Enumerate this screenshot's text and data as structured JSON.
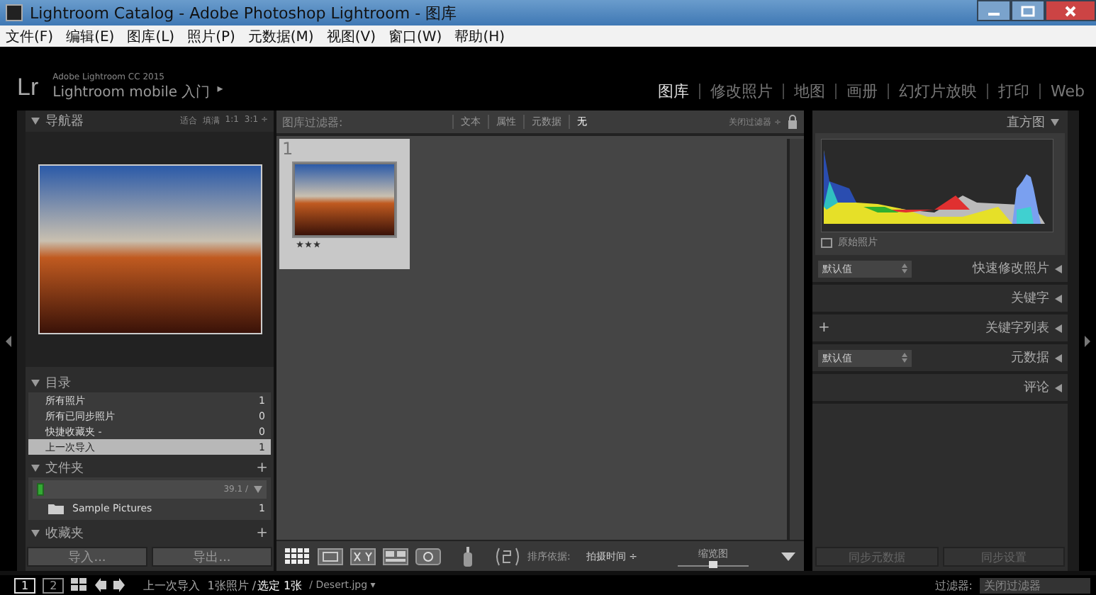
{
  "window": {
    "title": "Lightroom Catalog - Adobe Photoshop Lightroom - 图库"
  },
  "menu": [
    "文件(F)",
    "编辑(E)",
    "图库(L)",
    "照片(P)",
    "元数据(M)",
    "视图(V)",
    "窗口(W)",
    "帮助(H)"
  ],
  "identity": {
    "logo": "Lr",
    "product": "Adobe Lightroom CC 2015",
    "mobile": "Lightroom mobile 入门",
    "mobile_arrow": "▸"
  },
  "modules": [
    {
      "label": "图库",
      "selected": true
    },
    {
      "label": "修改照片",
      "selected": false
    },
    {
      "label": "地图",
      "selected": false
    },
    {
      "label": "画册",
      "selected": false
    },
    {
      "label": "幻灯片放映",
      "selected": false
    },
    {
      "label": "打印",
      "selected": false
    },
    {
      "label": "Web",
      "selected": false
    }
  ],
  "navigator": {
    "title": "导航器",
    "zoom_options": [
      {
        "label": "适合",
        "selected": false
      },
      {
        "label": "填满",
        "selected": false
      },
      {
        "label": "1:1",
        "selected": false
      },
      {
        "label": "3:1 ÷",
        "selected": false
      }
    ]
  },
  "catalog": {
    "title": "目录",
    "items": [
      {
        "label": "所有照片",
        "count": "1",
        "selected": false
      },
      {
        "label": "所有已同步照片",
        "count": "0",
        "selected": false
      },
      {
        "label": "快捷收藏夹 -",
        "count": "0",
        "selected": false
      },
      {
        "label": "上一次导入",
        "count": "1",
        "selected": true
      }
    ]
  },
  "folders": {
    "title": "文件夹",
    "add": "+",
    "volume_size": "39.1 /",
    "items": [
      {
        "label": "Sample Pictures",
        "count": "1"
      }
    ]
  },
  "collections": {
    "title": "收藏夹",
    "add": "+"
  },
  "left_buttons": [
    "导入...",
    "导出..."
  ],
  "filter_bar": {
    "label": "图库过滤器:",
    "options": [
      {
        "label": "文本",
        "selected": false
      },
      {
        "label": "属性",
        "selected": false
      },
      {
        "label": "元数据",
        "selected": false
      },
      {
        "label": "无",
        "selected": true
      }
    ],
    "preset": "关闭过滤器 ÷"
  },
  "grid": {
    "cells": [
      {
        "index": "1",
        "stars": 3,
        "selected": true
      }
    ]
  },
  "toolbar": {
    "sort_label": "排序依据:",
    "sort_value": "拍摄时间 ÷",
    "thumb_label": "缩览图",
    "thumb_slider": {
      "level": 0.5
    }
  },
  "right_panel": {
    "histogram_title": "直方图",
    "original_photo": {
      "label": "原始照片",
      "checked": false
    },
    "sections": [
      {
        "kind": "preset",
        "preset": "默认值",
        "title": "快速修改照片"
      },
      {
        "kind": "plain",
        "title": "关键字"
      },
      {
        "kind": "add",
        "add": "+",
        "title": "关键字列表"
      },
      {
        "kind": "preset",
        "preset": "默认值",
        "title": "元数据"
      },
      {
        "kind": "plain",
        "title": "评论"
      }
    ],
    "buttons": [
      "同步元数据",
      "同步设置"
    ]
  },
  "filmstrip": {
    "pages": [
      {
        "label": "1",
        "selected": true
      },
      {
        "label": "2",
        "selected": false
      }
    ],
    "source": "上一次导入",
    "info": "1张照片 / ",
    "selected_info": "选定 1张",
    "file": "/ Desert.jpg ▾",
    "filter_label": "过滤器:",
    "filter_value": "关闭过滤器"
  }
}
